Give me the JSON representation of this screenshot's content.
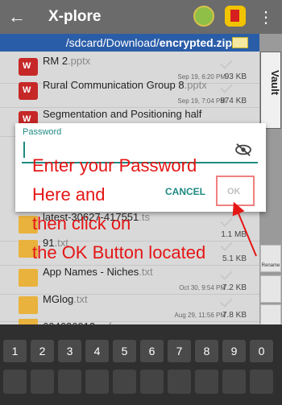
{
  "app": {
    "title": "X-plore",
    "back_icon": "arrow-left-icon",
    "menu_icon": "more-vert-icon"
  },
  "pathbar": {
    "prefix": "/sdcard/Download/",
    "current": "encrypted.zip"
  },
  "sidebar": {
    "vault_label": "Vault",
    "rename_label": "Rename"
  },
  "files": [
    {
      "name": "RM 2",
      "ext": ".pptx",
      "date": "Sep 19, 6:20 PM",
      "size": "93 KB"
    },
    {
      "name": "Rural Communication Group 8",
      "ext": ".pptx",
      "date": "Sep 19, 7:04 PM",
      "size": "874 KB"
    },
    {
      "name": "Segmentation and Positioning half",
      "ext": "",
      "date": "",
      "size": ""
    },
    {
      "name": "latest-30627-417551",
      "ext": ".ts",
      "date": "",
      "size": "1.1 MB"
    },
    {
      "name": "91",
      "ext": ".txt",
      "date": "",
      "size": "5.1 KB"
    },
    {
      "name": "App Names - Niches",
      "ext": ".txt",
      "date": "Oct 30, 9:54 PM",
      "size": "7.2 KB"
    },
    {
      "name": "MGlog",
      "ext": ".txt",
      "date": "Aug 29, 11:56 PM",
      "size": "7.8 KB"
    },
    {
      "name": "604626013",
      "ext": ".vcf",
      "date": "",
      "size": ""
    }
  ],
  "dialog": {
    "label": "Password",
    "value": "",
    "cancel": "CANCEL",
    "ok": "OK"
  },
  "annotation": {
    "line1": "Enter your Password",
    "line2": "Here and",
    "line3": "then click on",
    "line4": "the OK Button located"
  },
  "keyboard": {
    "keys": [
      "1",
      "2",
      "3",
      "4",
      "5",
      "6",
      "7",
      "8",
      "9",
      "0"
    ]
  },
  "colors": {
    "accent": "#1e8a82",
    "annotation": "#e51515",
    "pathbar": "#2a5da8"
  }
}
